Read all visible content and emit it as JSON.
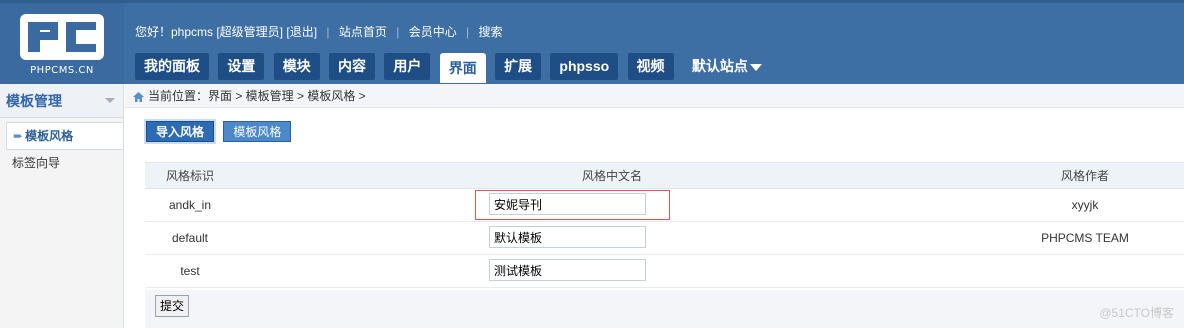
{
  "logo": {
    "text": "PHPCMS.CN"
  },
  "topbar": {
    "greeting": "您好！phpcms [超级管理员]",
    "logout": "[退出]",
    "site_home": "站点首页",
    "member_center": "会员中心",
    "search": "搜索"
  },
  "nav": {
    "items": [
      {
        "label": "我的面板"
      },
      {
        "label": "设置"
      },
      {
        "label": "模块"
      },
      {
        "label": "内容"
      },
      {
        "label": "用户"
      },
      {
        "label": "界面"
      },
      {
        "label": "扩展"
      },
      {
        "label": "phpsso"
      },
      {
        "label": "视频"
      }
    ],
    "active_index": 5,
    "site_selector": "默认站点"
  },
  "sidebar": {
    "title": "模板管理",
    "items": [
      {
        "label": "模板风格"
      },
      {
        "label": "标签向导"
      }
    ]
  },
  "breadcrumb": {
    "text": "当前位置：界面 > 模板管理 > 模板风格 >"
  },
  "buttons": {
    "import": "导入风格",
    "styles": "模板风格"
  },
  "table": {
    "headers": [
      "风格标识",
      "风格中文名",
      "风格作者"
    ],
    "rows": [
      {
        "id": "andk_in",
        "name": "安妮导刊",
        "author": "xyyjk"
      },
      {
        "id": "default",
        "name": "默认模板",
        "author": "PHPCMS TEAM"
      },
      {
        "id": "test",
        "name": "测试模板",
        "author": ""
      }
    ]
  },
  "submit_label": "提交",
  "watermark": "@51CTO博客",
  "colors": {
    "header": "#3d6ea4",
    "nav_button": "#1f4e86",
    "highlight": "#e05555"
  }
}
